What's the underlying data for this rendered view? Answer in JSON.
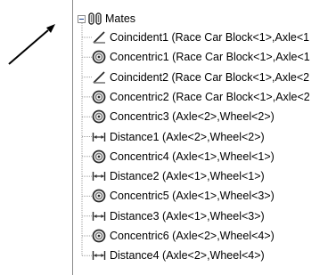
{
  "tree": {
    "root": {
      "label": "Mates",
      "icon": "mates-folder-icon"
    },
    "items": [
      {
        "type": "coincident",
        "icon": "coincident-mate-icon",
        "label": "Coincident1 (Race Car Block<1>,Axle<1"
      },
      {
        "type": "concentric",
        "icon": "concentric-mate-icon",
        "label": "Concentric1 (Race Car Block<1>,Axle<1"
      },
      {
        "type": "coincident",
        "icon": "coincident-mate-icon",
        "label": "Coincident2 (Race Car Block<1>,Axle<2"
      },
      {
        "type": "concentric",
        "icon": "concentric-mate-icon",
        "label": "Concentric2 (Race Car Block<1>,Axle<2"
      },
      {
        "type": "concentric",
        "icon": "concentric-mate-icon",
        "label": "Concentric3 (Axle<2>,Wheel<2>)"
      },
      {
        "type": "distance",
        "icon": "distance-mate-icon",
        "label": "Distance1 (Axle<2>,Wheel<2>)"
      },
      {
        "type": "concentric",
        "icon": "concentric-mate-icon",
        "label": "Concentric4 (Axle<1>,Wheel<1>)"
      },
      {
        "type": "distance",
        "icon": "distance-mate-icon",
        "label": "Distance2 (Axle<1>,Wheel<1>)"
      },
      {
        "type": "concentric",
        "icon": "concentric-mate-icon",
        "label": "Concentric5 (Axle<1>,Wheel<3>)"
      },
      {
        "type": "distance",
        "icon": "distance-mate-icon",
        "label": "Distance3 (Axle<1>,Wheel<3>)"
      },
      {
        "type": "concentric",
        "icon": "concentric-mate-icon",
        "label": "Concentric6 (Axle<2>,Wheel<4>)"
      },
      {
        "type": "distance",
        "icon": "distance-mate-icon",
        "label": "Distance4 (Axle<2>,Wheel<4>)"
      }
    ]
  },
  "colors": {
    "tree_line": "#a0a0a0",
    "expander_sign": "#1a3e8a",
    "icon_dark": "#2b2b2b",
    "icon_gray": "#7a7a7a",
    "pointer": "#000000"
  }
}
